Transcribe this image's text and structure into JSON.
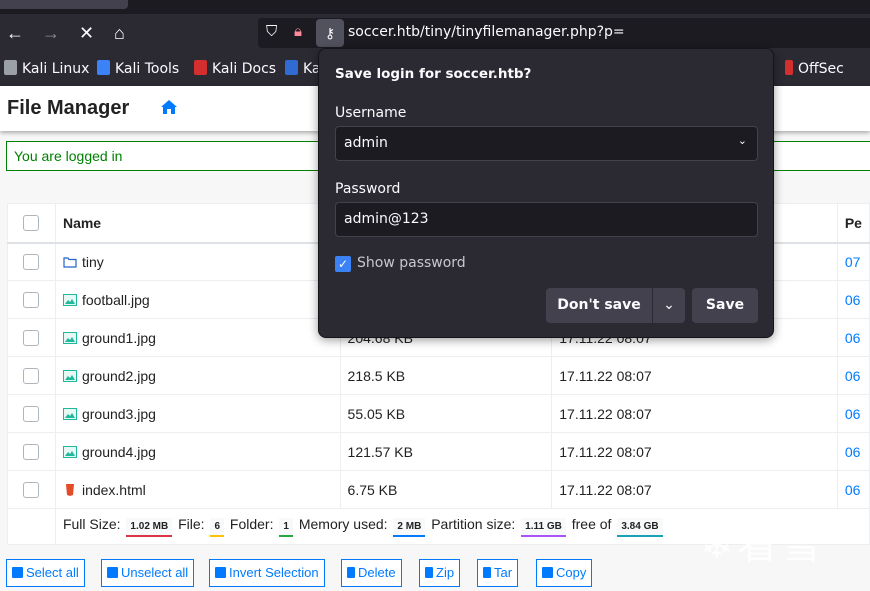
{
  "browser": {
    "url": "soccer.htb/tiny/tinyfilemanager.php?p=",
    "bookmarks": [
      {
        "label": "Kali Linux",
        "color": "#9aa0a6"
      },
      {
        "label": "Kali Tools",
        "color": "#3b82f6"
      },
      {
        "label": "Kali Docs",
        "color": "#d32f2f"
      },
      {
        "label": "Ka",
        "color": "#2f6bd3"
      },
      {
        "label": "OffSec",
        "color": "#d32f2f"
      }
    ]
  },
  "popup": {
    "title": "Save login for soccer.htb?",
    "username_label": "Username",
    "username_value": "admin",
    "password_label": "Password",
    "password_value": "admin@123",
    "show_password_label": "Show password",
    "show_password_checked": true,
    "dont_save_label": "Don't save",
    "save_label": "Save"
  },
  "app": {
    "title": "File Manager",
    "alert": "You are logged in",
    "accent": "#007bff"
  },
  "table": {
    "headers": [
      "Name",
      "",
      "",
      "Pe"
    ],
    "rows": [
      {
        "name": "tiny",
        "type": "folder",
        "size": "",
        "modified": "",
        "perms": "07"
      },
      {
        "name": "football.jpg",
        "type": "image",
        "size": "",
        "modified": "",
        "perms": "06"
      },
      {
        "name": "ground1.jpg",
        "type": "image",
        "size": "204.68 KB",
        "modified": "17.11.22 08:07",
        "perms": "06"
      },
      {
        "name": "ground2.jpg",
        "type": "image",
        "size": "218.5 KB",
        "modified": "17.11.22 08:07",
        "perms": "06"
      },
      {
        "name": "ground3.jpg",
        "type": "image",
        "size": "55.05 KB",
        "modified": "17.11.22 08:07",
        "perms": "06"
      },
      {
        "name": "ground4.jpg",
        "type": "image",
        "size": "121.57 KB",
        "modified": "17.11.22 08:07",
        "perms": "06"
      },
      {
        "name": "index.html",
        "type": "html",
        "size": "6.75 KB",
        "modified": "17.11.22 08:07",
        "perms": "06"
      }
    ],
    "footer": {
      "full_size_label": "Full Size:",
      "full_size": "1.02 MB",
      "file_label": "File:",
      "files": "6",
      "folder_label": "Folder:",
      "folders": "1",
      "memory_label": "Memory used:",
      "memory": "2 MB",
      "partition_label": "Partition size:",
      "partition": "1.11 GB",
      "free_label": "free of",
      "total": "3.84 GB"
    }
  },
  "actions": [
    "Select all",
    "Unselect all",
    "Invert Selection",
    "Delete",
    "Zip",
    "Tar",
    "Copy"
  ],
  "watermark": "看雪"
}
